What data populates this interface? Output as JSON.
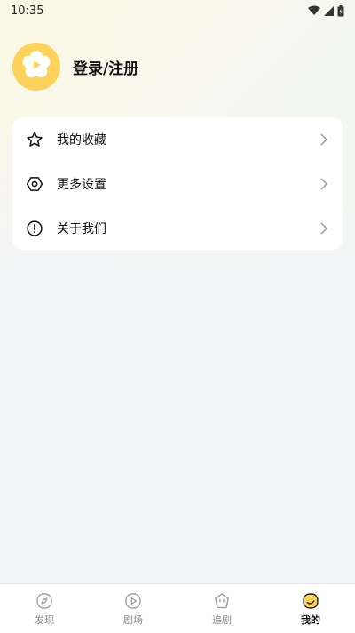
{
  "status_bar": {
    "time": "10:35"
  },
  "profile": {
    "login_label": "登录/注册",
    "avatar_color": "#fdd25a"
  },
  "menu": {
    "items": [
      {
        "label": "我的收藏",
        "icon": "star-icon"
      },
      {
        "label": "更多设置",
        "icon": "settings-icon"
      },
      {
        "label": "关于我们",
        "icon": "info-icon"
      }
    ]
  },
  "tabbar": {
    "tabs": [
      {
        "label": "发现",
        "icon": "compass-icon",
        "active": false
      },
      {
        "label": "剧场",
        "icon": "play-icon",
        "active": false
      },
      {
        "label": "追剧",
        "icon": "follow-icon",
        "active": false
      },
      {
        "label": "我的",
        "icon": "profile-icon",
        "active": true
      }
    ]
  },
  "colors": {
    "accent": "#fdd25a",
    "background": "#f4f5f7"
  }
}
